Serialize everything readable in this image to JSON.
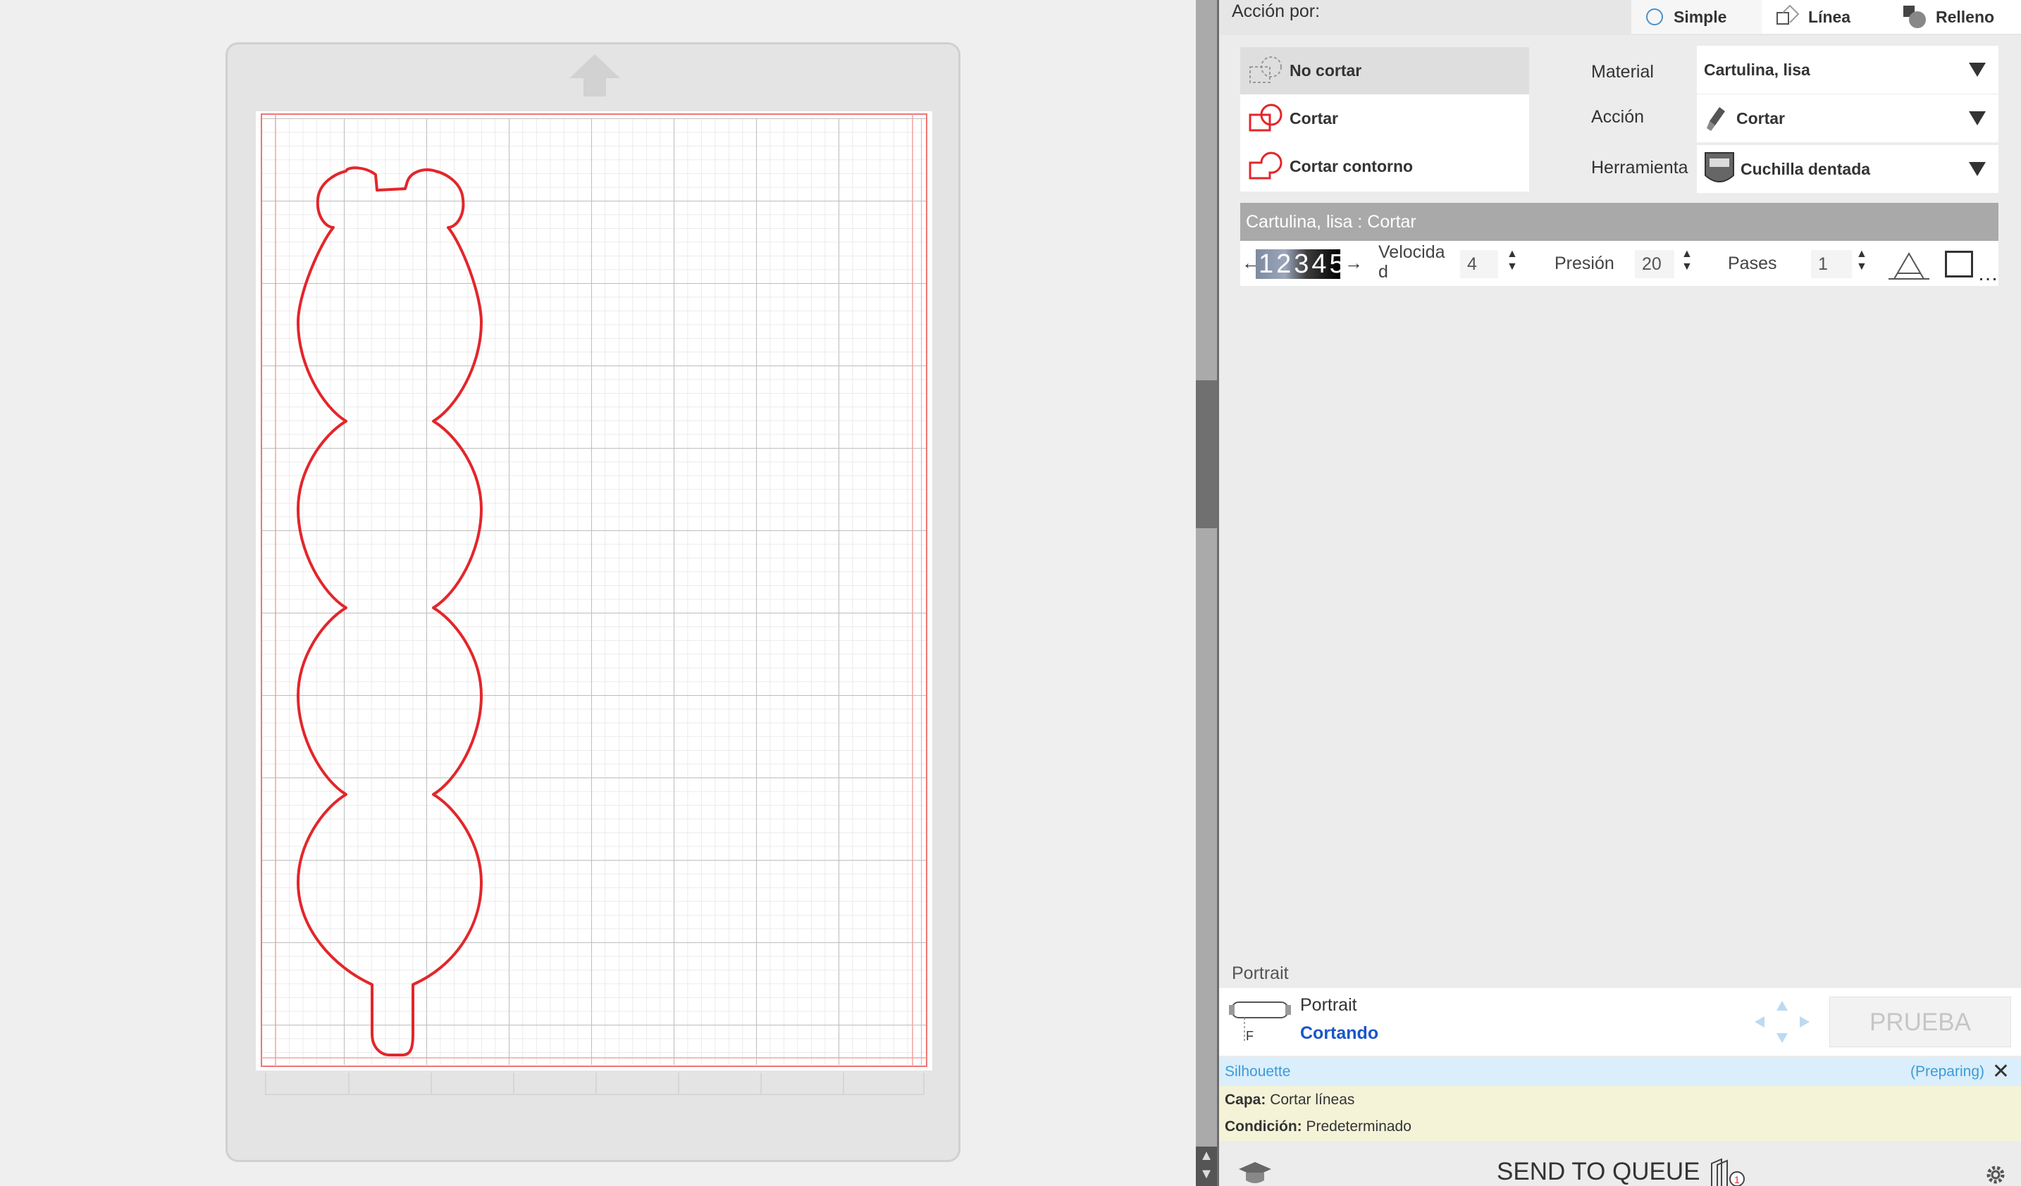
{
  "panel": {
    "action_by_label": "Acción por:",
    "modes": [
      {
        "label": "Simple"
      },
      {
        "label": "Línea"
      },
      {
        "label": "Relleno"
      }
    ],
    "cut_options": [
      {
        "label": "No cortar",
        "selected": true
      },
      {
        "label": "Cortar",
        "selected": false
      },
      {
        "label": "Cortar contorno",
        "selected": false
      }
    ],
    "properties": {
      "material_label": "Material",
      "material_value": "Cartulina, lisa",
      "action_label": "Acción",
      "action_value": "Cortar",
      "tool_label": "Herramienta",
      "tool_value": "Cuchilla dentada"
    },
    "condition": {
      "header": "Cartulina, lisa : Cortar",
      "blade_numbers": "12345",
      "speed_label_1": "Velocida",
      "speed_label_2": "d",
      "speed_value": "4",
      "pressure_label": "Presión",
      "pressure_value": "20",
      "passes_label": "Pases",
      "passes_value": "1"
    },
    "device": {
      "section_label": "Portrait",
      "name": "Portrait",
      "status": "Cortando",
      "test_button": "PRUEBA"
    },
    "status_bar": {
      "name": "Silhouette",
      "state": "(Preparing)"
    },
    "info": {
      "layer_label": "Capa:",
      "layer_value": "Cortar líneas",
      "condition_label": "Condición:",
      "condition_value": "Predeterminado"
    },
    "send_to_queue": "SEND TO QUEUE"
  },
  "colors": {
    "cut_line": "#e3262b",
    "accent_blue": "#1a56c8",
    "status_blue": "#3b9cd6"
  }
}
